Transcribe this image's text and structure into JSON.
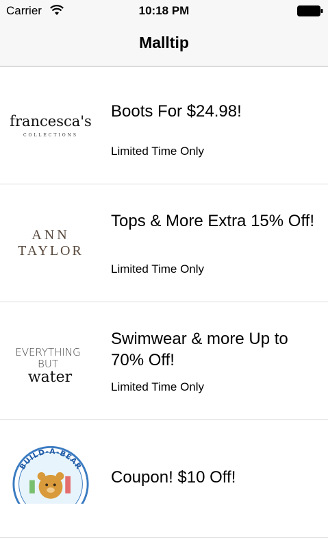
{
  "status_bar": {
    "carrier": "Carrier",
    "time": "10:18 PM",
    "wifi_icon": "wifi-icon",
    "battery_icon": "battery-icon"
  },
  "nav": {
    "title": "Malltip"
  },
  "deals": [
    {
      "store_logo_text": "francesca's",
      "store_logo_subtext": "COLLECTIONS",
      "title": "Boots For $24.98!",
      "subtitle": "Limited Time Only"
    },
    {
      "store_logo_text": "ANN",
      "store_logo_subtext": "TAYLOR",
      "title": "Tops & More Extra 15% Off!",
      "subtitle": "Limited Time Only"
    },
    {
      "store_logo_text": "EVERYTHING",
      "store_logo_subtext": "BUT",
      "store_logo_subtext2": "water",
      "title": "Swimwear & more Up to 70% Off!",
      "subtitle": "Limited Time Only"
    },
    {
      "store_logo_text": "BUILD-A-BEAR",
      "title": "Coupon! $10 Off!"
    }
  ]
}
